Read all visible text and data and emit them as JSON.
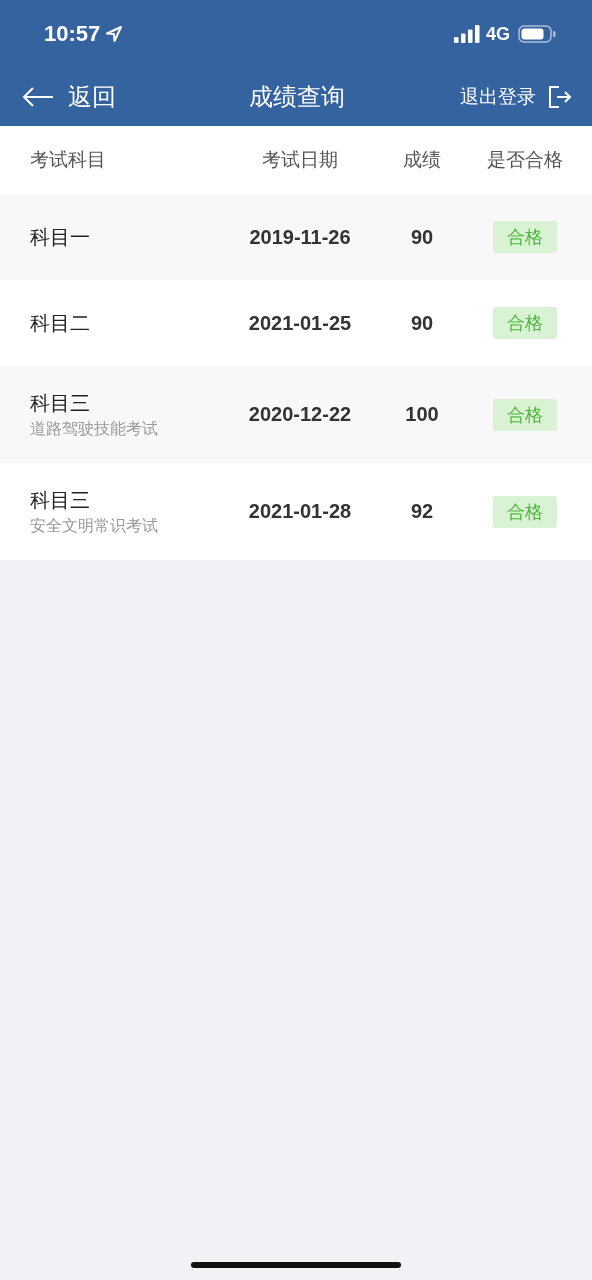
{
  "status_bar": {
    "time": "10:57",
    "network": "4G"
  },
  "nav": {
    "back": "返回",
    "title": "成绩查询",
    "logout": "退出登录"
  },
  "table": {
    "columns": [
      "考试科目",
      "考试日期",
      "成绩",
      "是否合格"
    ],
    "rows": [
      {
        "subject": "科目一",
        "date": "2019-11-26",
        "score": "90",
        "result": "合格",
        "passed": true
      },
      {
        "subject": "科目二",
        "date": "2021-01-25",
        "score": "90",
        "result": "合格",
        "passed": true
      },
      {
        "subject": "科目三",
        "subtitle": "道路驾驶技能考试",
        "date": "2020-12-22",
        "score": "100",
        "result": "合格",
        "passed": true
      },
      {
        "subject": "科目三",
        "subtitle": "安全文明常识考试",
        "date": "2021-01-28",
        "score": "92",
        "result": "合格",
        "passed": true
      }
    ]
  }
}
